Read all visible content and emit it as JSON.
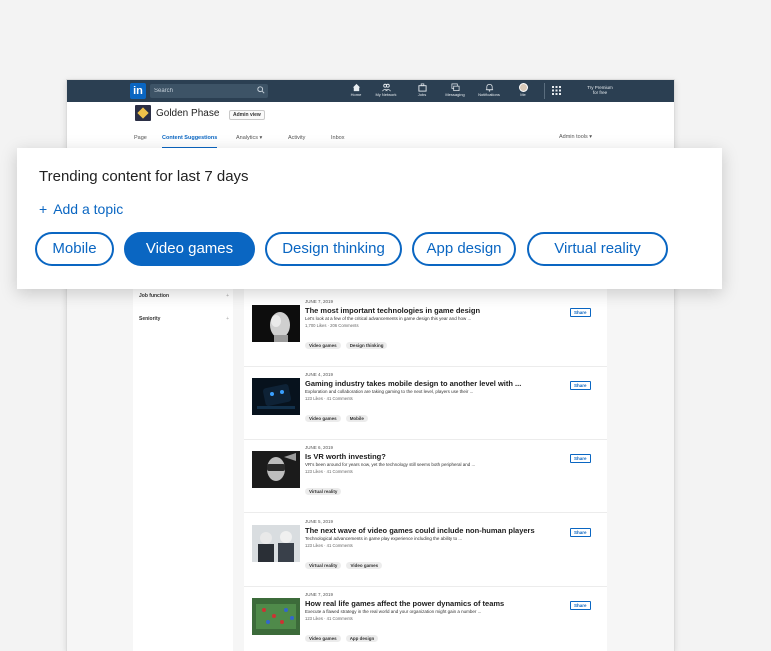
{
  "navbar": {
    "logo": "in",
    "search_placeholder": "Search",
    "items": [
      {
        "label": "Home",
        "icon": "home-icon"
      },
      {
        "label": "My Network",
        "icon": "network-icon"
      },
      {
        "label": "Jobs",
        "icon": "briefcase-icon"
      },
      {
        "label": "Messaging",
        "icon": "messaging-icon"
      },
      {
        "label": "Notifications",
        "icon": "bell-icon"
      },
      {
        "label": "Me",
        "icon": "avatar"
      }
    ],
    "right_text_line1": "Try Premium",
    "right_text_line2": "for free"
  },
  "company": {
    "name": "Golden Phase",
    "badge": "Admin view"
  },
  "tabs": [
    {
      "label": "Page"
    },
    {
      "label": "Content Suggestions"
    },
    {
      "label": "Analytics ▾"
    },
    {
      "label": "Activity"
    },
    {
      "label": "Inbox"
    }
  ],
  "admin_tools": "Admin tools ▾",
  "sidebar": {
    "filters": [
      {
        "label": "Job function"
      },
      {
        "label": "Seniority"
      }
    ]
  },
  "trending": {
    "title": "Trending content for last 7 days",
    "add_topic": "Add a topic",
    "chips": [
      {
        "label": "Mobile",
        "selected": false
      },
      {
        "label": "Video games",
        "selected": true
      },
      {
        "label": "Design thinking",
        "selected": false
      },
      {
        "label": "App design",
        "selected": false
      },
      {
        "label": "Virtual reality",
        "selected": false
      }
    ]
  },
  "posts": [
    {
      "date": "JUNE 7, 2019",
      "title": "The most important technologies in game design",
      "desc": "Let's look at a few of the critical advancements in game design this year and how ...",
      "stats": "1,700 Likes · 206 Comments",
      "tags": [
        "Video games",
        "Design thinking"
      ],
      "share": "Share"
    },
    {
      "date": "JUNE 4, 2019",
      "title": "Gaming industry takes mobile design to another level with ...",
      "desc": "Exploration and collaboration are taking gaming to the next level, players use their ...",
      "stats": "123 Likes · 41 Comments",
      "tags": [
        "Video games",
        "Mobile"
      ],
      "share": "Share"
    },
    {
      "date": "JUNE 6, 2019",
      "title": "Is VR worth investing?",
      "desc": "VR's been around for years now, yet the technology still seems both peripheral and ...",
      "stats": "123 Likes · 41 Comments",
      "tags": [
        "Virtual reality"
      ],
      "share": "Share"
    },
    {
      "date": "JUNE 5, 2019",
      "title": "The next wave of video games could include non-human players",
      "desc": "Technological advancements in game play experience including the ability to ...",
      "stats": "123 Likes · 41 Comments",
      "tags": [
        "Virtual reality",
        "Video games"
      ],
      "share": "Share"
    },
    {
      "date": "JUNE 7, 2019",
      "title": "How real life games affect the power dynamics of teams",
      "desc": "Execute a flawed strategy in the real world and your organization might gain a number ...",
      "stats": "123 Likes · 41 Comments",
      "tags": [
        "Video games",
        "App design"
      ],
      "share": "Share"
    }
  ],
  "colors": {
    "brand": "#0a66c2",
    "navbar": "#2b3f52"
  }
}
